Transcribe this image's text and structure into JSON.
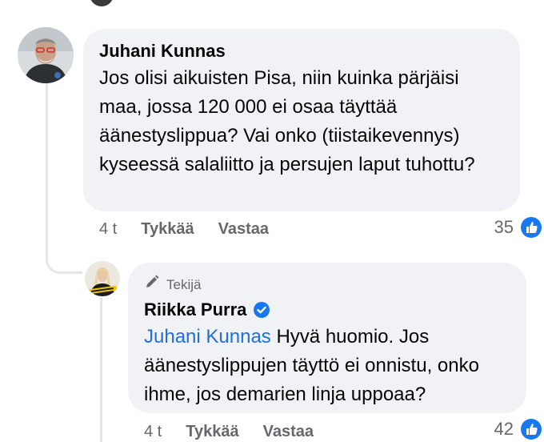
{
  "comment": {
    "author": "Juhani Kunnas",
    "text": "Jos olisi aikuisten Pisa, niin kuinka pärjäisi maa, jossa 120 000 ei osaa täyttää äänestyslippua? Vai onko (tiistaikevennys) kyseessä salaliitto ja persujen laput tuhottu?",
    "time": "4 t",
    "like_label": "Tykkää",
    "reply_label": "Vastaa",
    "reaction_count": "35"
  },
  "reply": {
    "badge": "Tekijä",
    "author": "Riikka Purra",
    "mention": "Juhani Kunnas",
    "text": " Hyvä huomio. Jos äänestyslippujen täyttö ei onnistu, onko ihme, jos demarien linja uppoaa?",
    "time": "4 t",
    "like_label": "Tykkää",
    "reply_label": "Vastaa",
    "reaction_count": "42"
  },
  "icons": {
    "like": "like-thumb-icon",
    "verified": "verified-check-icon",
    "author_badge": "pen-icon"
  },
  "colors": {
    "bubble": "#f0f2f5",
    "meta_text": "#65676b",
    "mention": "#216fdb",
    "accent": "#1877f2"
  }
}
